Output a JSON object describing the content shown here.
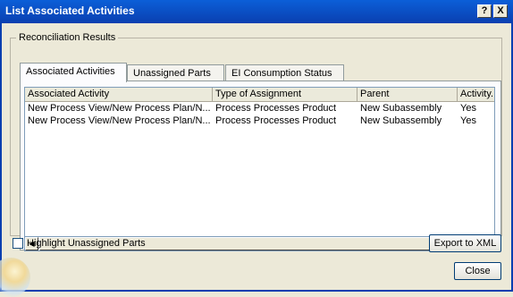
{
  "window": {
    "title": "List Associated Activities",
    "help_btn": "?",
    "close_btn": "X"
  },
  "group": {
    "legend": "Reconciliation Results"
  },
  "tabs": [
    {
      "label": "Associated Activities",
      "active": true
    },
    {
      "label": "Unassigned Parts",
      "active": false
    },
    {
      "label": "EI Consumption Status",
      "active": false
    }
  ],
  "table": {
    "columns": [
      "Associated Activity",
      "Type of Assignment",
      "Parent",
      "Activity..."
    ],
    "rows": [
      [
        "New Process View/New Process Plan/N...",
        "Process Processes Product",
        "New Subassembly",
        "Yes"
      ],
      [
        "New Process View/New Process Plan/N...",
        "Process Processes Product",
        "New Subassembly",
        "Yes"
      ]
    ]
  },
  "scroll": {
    "left_icon": "scroll-left-arrow",
    "right_icon": "scroll-right-arrow"
  },
  "highlight": {
    "label": "Highlight Unassigned Parts",
    "checked": false
  },
  "buttons": {
    "export": "Export to XML",
    "close": "Close"
  }
}
